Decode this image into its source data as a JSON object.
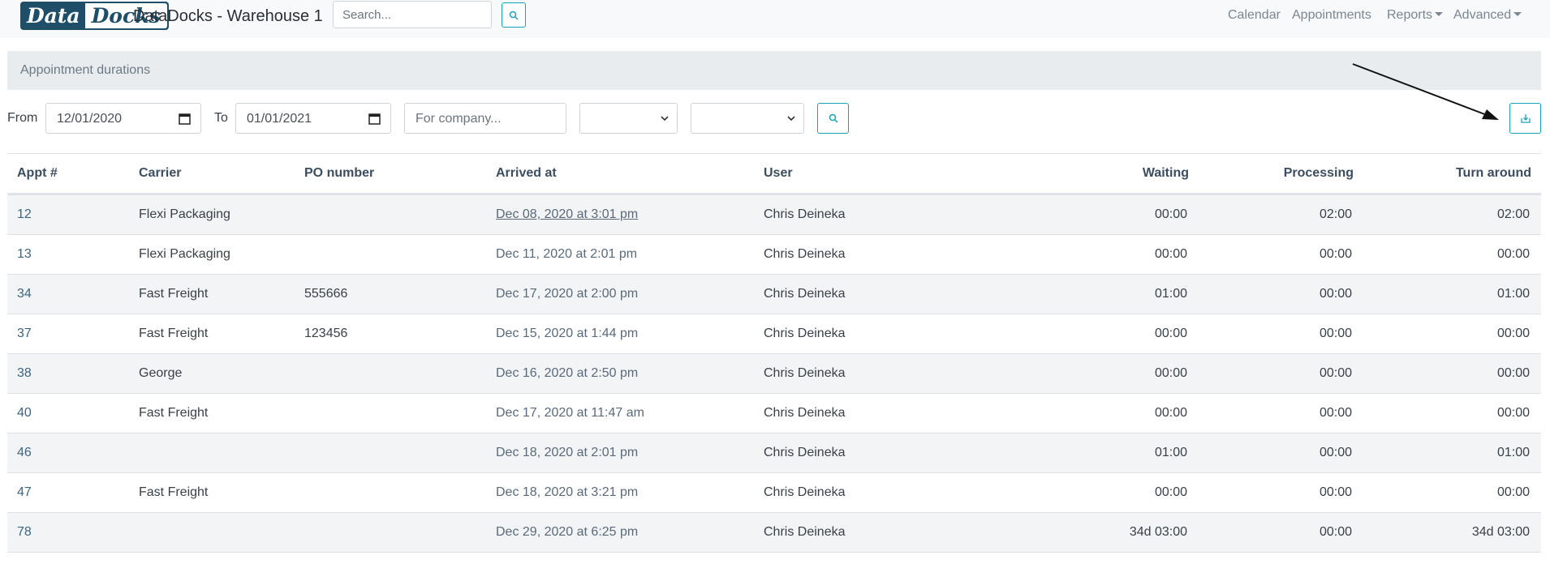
{
  "nav": {
    "logo_part1": "Data",
    "logo_part2": "Docks",
    "title": "DataDocks - Warehouse 1",
    "search_placeholder": "Search...",
    "links": {
      "calendar": "Calendar",
      "appointments": "Appointments",
      "reports": "Reports",
      "advanced": "Advanced"
    }
  },
  "card": {
    "header": "Appointment durations"
  },
  "filters": {
    "from_label": "From",
    "from_value": "12/01/2020",
    "to_label": "To",
    "to_value": "01/01/2021",
    "company_placeholder": "For company...",
    "select1_value": "",
    "select2_value": ""
  },
  "table": {
    "headers": {
      "appt": "Appt #",
      "carrier": "Carrier",
      "po": "PO number",
      "arrived": "Arrived at",
      "user": "User",
      "waiting": "Waiting",
      "processing": "Processing",
      "turnaround": "Turn around"
    },
    "rows": [
      {
        "appt": "12",
        "carrier": "Flexi Packaging",
        "po": "",
        "arrived": "Dec 08, 2020 at 3:01 pm",
        "user": "Chris Deineka",
        "waiting": "00:00",
        "processing": "02:00",
        "turnaround": "02:00"
      },
      {
        "appt": "13",
        "carrier": "Flexi Packaging",
        "po": "",
        "arrived": "Dec 11, 2020 at 2:01 pm",
        "user": "Chris Deineka",
        "waiting": "00:00",
        "processing": "00:00",
        "turnaround": "00:00"
      },
      {
        "appt": "34",
        "carrier": "Fast Freight",
        "po": "555666",
        "arrived": "Dec 17, 2020 at 2:00 pm",
        "user": "Chris Deineka",
        "waiting": "01:00",
        "processing": "00:00",
        "turnaround": "01:00"
      },
      {
        "appt": "37",
        "carrier": "Fast Freight",
        "po": "123456",
        "arrived": "Dec 15, 2020 at 1:44 pm",
        "user": "Chris Deineka",
        "waiting": "00:00",
        "processing": "00:00",
        "turnaround": "00:00"
      },
      {
        "appt": "38",
        "carrier": "George",
        "po": "",
        "arrived": "Dec 16, 2020 at 2:50 pm",
        "user": "Chris Deineka",
        "waiting": "00:00",
        "processing": "00:00",
        "turnaround": "00:00"
      },
      {
        "appt": "40",
        "carrier": "Fast Freight",
        "po": "",
        "arrived": "Dec 17, 2020 at 11:47 am",
        "user": "Chris Deineka",
        "waiting": "00:00",
        "processing": "00:00",
        "turnaround": "00:00"
      },
      {
        "appt": "46",
        "carrier": "",
        "po": "",
        "arrived": "Dec 18, 2020 at 2:01 pm",
        "user": "Chris Deineka",
        "waiting": "01:00",
        "processing": "00:00",
        "turnaround": "01:00"
      },
      {
        "appt": "47",
        "carrier": "Fast Freight",
        "po": "",
        "arrived": "Dec 18, 2020 at 3:21 pm",
        "user": "Chris Deineka",
        "waiting": "00:00",
        "processing": "00:00",
        "turnaround": "00:00"
      },
      {
        "appt": "78",
        "carrier": "",
        "po": "",
        "arrived": "Dec 29, 2020 at 6:25 pm",
        "user": "Chris Deineka",
        "waiting": "34d 03:00",
        "processing": "00:00",
        "turnaround": "34d 03:00"
      }
    ]
  },
  "icons": {
    "search": "search-icon",
    "download": "download-icon",
    "calendar": "calendar-icon"
  },
  "colors": {
    "accent": "#17a2b8",
    "brand": "#1f4e68"
  }
}
